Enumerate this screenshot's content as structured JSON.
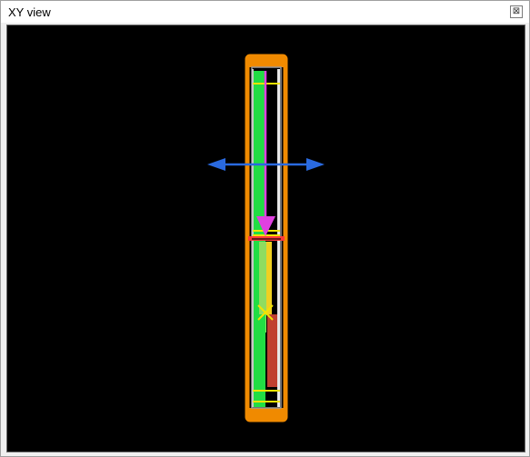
{
  "window": {
    "title": "XY view",
    "close_glyph": "⊠"
  },
  "scene": {
    "background": "#000000",
    "accent": {
      "housing": "#f08a00",
      "fill_green": "#22dd44",
      "fill_light_green": "#8fdc60",
      "fill_yellow": "#f0d020",
      "fill_red": "#c04030",
      "axis_blue": "#2a6ae0",
      "arrow_magenta": "#e040e0",
      "marker_yellow": "#f2e400",
      "divider_red": "#ff3a3a"
    },
    "icons": [
      "move-horizontal-arrow",
      "move-down-arrow",
      "center-cross-marker"
    ]
  }
}
